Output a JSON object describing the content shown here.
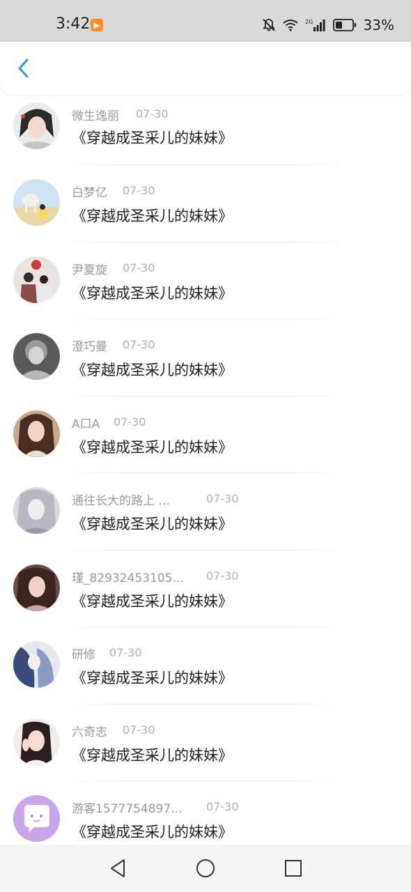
{
  "status_bar": {
    "time": "3:42",
    "battery": "33%",
    "icons": [
      "app-notification-icon",
      "mute-bell-icon",
      "wifi-icon",
      "signal-2g-icon",
      "battery-icon"
    ]
  },
  "header": {
    "back_icon": "chevron-left-icon",
    "accent_color": "#2a9fd8"
  },
  "comments": [
    {
      "user": "微生逸丽",
      "date": "07-30",
      "title": "《穿越成圣采儿的妹妹》"
    },
    {
      "user": "白梦亿",
      "date": "07-30",
      "title": "《穿越成圣采儿的妹妹》"
    },
    {
      "user": "尹夏旋",
      "date": "07-30",
      "title": "《穿越成圣采儿的妹妹》"
    },
    {
      "user": "澄巧曼",
      "date": "07-30",
      "title": "《穿越成圣采儿的妹妹》"
    },
    {
      "user": "A口A",
      "date": "07-30",
      "title": "《穿越成圣采儿的妹妹》"
    },
    {
      "user": "通往长大的路上 …",
      "date": "07-30",
      "title": "《穿越成圣采儿的妹妹》"
    },
    {
      "user": "瑾_82932453105…",
      "date": "07-30",
      "title": "《穿越成圣采儿的妹妹》"
    },
    {
      "user": "研修",
      "date": "07-30",
      "title": "《穿越成圣采儿的妹妹》"
    },
    {
      "user": "六奇志",
      "date": "07-30",
      "title": "《穿越成圣采儿的妹妹》"
    },
    {
      "user": "游客1577754897…",
      "date": "07-30",
      "title": "《穿越成圣采儿的妹妹》"
    }
  ],
  "nav_bar": {
    "icons": [
      "back-triangle-icon",
      "home-circle-icon",
      "recents-square-icon"
    ]
  }
}
